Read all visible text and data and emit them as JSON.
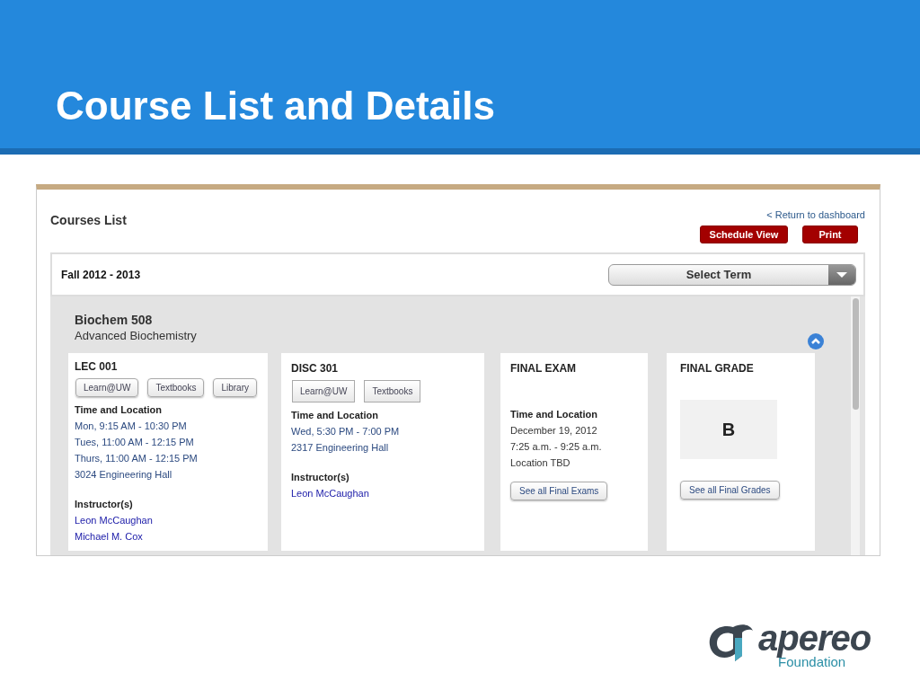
{
  "slide": {
    "title": "Course List and Details"
  },
  "courses_list": {
    "title": "Courses List",
    "return_link": "< Return to dashboard",
    "buttons": [
      "Schedule View",
      "Print"
    ],
    "term": {
      "label": "Fall 2012 - 2013",
      "select": "Select Term"
    },
    "course": {
      "code": "Biochem 508",
      "name": "Advanced Biochemistry",
      "expanded": true,
      "sections": [
        {
          "kind": "section",
          "code": "LEC 001",
          "rounded": true,
          "buttons": [
            "Learn@UW",
            "Textbooks",
            "Library"
          ],
          "time_heading": "Time and Location",
          "times": [
            "Mon, 9:15 AM - 10:30 PM",
            "Tues, 11:00 AM - 12:15 PM",
            "Thurs, 11:00 AM - 12:15 PM",
            "3024 Engineering Hall"
          ],
          "instructors_heading": "Instructor(s)",
          "instructors": [
            "Leon McCaughan",
            "Michael M. Cox"
          ]
        },
        {
          "kind": "section",
          "code": "DISC 301",
          "rounded": false,
          "buttons": [
            "Learn@UW",
            "Textbooks"
          ],
          "time_heading": "Time and Location",
          "times": [
            "Wed, 5:30 PM - 7:00 PM",
            "2317 Engineering Hall"
          ],
          "instructors_heading": "Instructor(s)",
          "instructors": [
            "Leon McCaughan"
          ]
        },
        {
          "kind": "exam",
          "title": "FINAL EXAM",
          "heading": "Time and Location",
          "lines": [
            "December 19, 2012",
            "7:25 a.m. - 9:25 a.m.",
            "Location TBD"
          ],
          "button": "See all Final Exams"
        },
        {
          "kind": "grade",
          "title": "FINAL GRADE",
          "grade": "B",
          "button": "See all Final Grades"
        }
      ]
    }
  },
  "logo": {
    "name": "apereo",
    "tagline": "Foundation"
  }
}
